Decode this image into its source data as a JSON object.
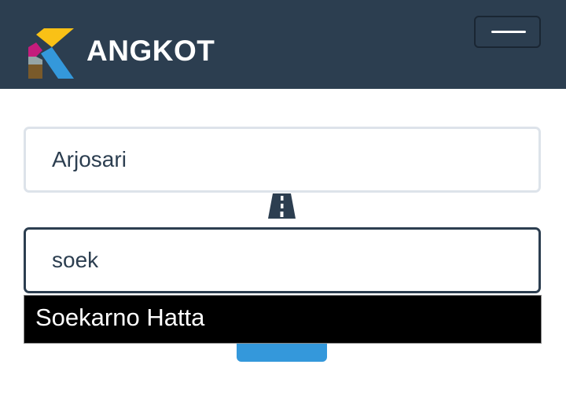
{
  "app": {
    "brand": "ANGKOT",
    "logo_icon": "angkot-k-logo",
    "menu_icon": "hamburger-icon"
  },
  "colors": {
    "navbar": "#2c3e50",
    "accent": "#3498db",
    "field_border": "#dde3ea",
    "field_focus_border": "#2c3e50",
    "text": "#2c3e50"
  },
  "form": {
    "origin": {
      "value": "Arjosari"
    },
    "destination": {
      "value": "soek"
    },
    "separator_icon": "road-icon",
    "submit_label": ""
  },
  "autocomplete": {
    "items": [
      {
        "label": "Soekarno Hatta"
      }
    ]
  }
}
